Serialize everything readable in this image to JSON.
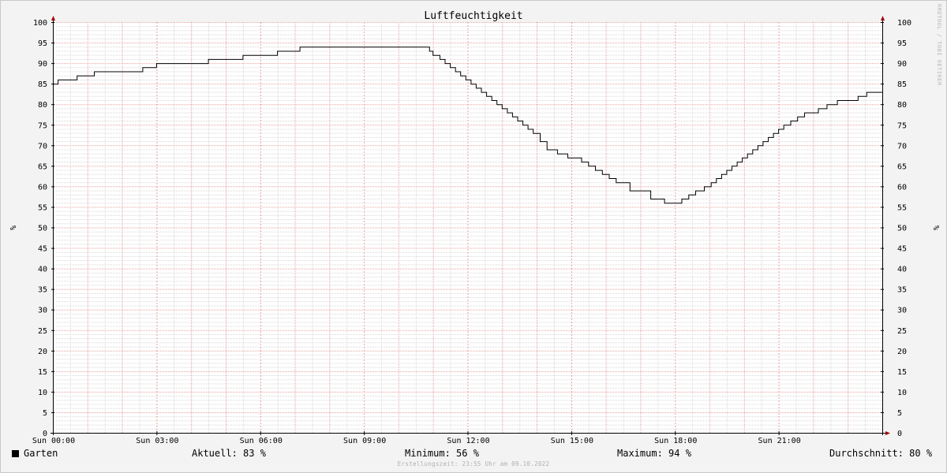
{
  "chart_data": {
    "type": "line",
    "title": "Luftfeuchtigkeit",
    "ylabel": "%",
    "ylim": [
      0,
      100
    ],
    "y_ticks": [
      0,
      5,
      10,
      15,
      20,
      25,
      30,
      35,
      40,
      45,
      50,
      55,
      60,
      65,
      70,
      75,
      80,
      85,
      90,
      95,
      100
    ],
    "x_unit": "hours",
    "xlim": [
      0,
      24
    ],
    "x_tick_values": [
      0,
      3,
      6,
      9,
      12,
      15,
      18,
      21
    ],
    "x_tick_labels": [
      "Sun 00:00",
      "Sun 03:00",
      "Sun 06:00",
      "Sun 09:00",
      "Sun 12:00",
      "Sun 15:00",
      "Sun 18:00",
      "Sun 21:00"
    ],
    "grid": true,
    "step": true,
    "series": [
      {
        "name": "Garten",
        "color": "#000000",
        "x": [
          0,
          0.15,
          0.7,
          1.2,
          1.9,
          2.6,
          2.8,
          3.0,
          3.5,
          4.0,
          4.5,
          5.0,
          5.5,
          5.7,
          6.0,
          6.5,
          7.0,
          7.15,
          7.5,
          8.0,
          8.5,
          9.0,
          9.5,
          10.0,
          10.5,
          10.9,
          11.0,
          11.2,
          11.35,
          11.5,
          11.65,
          11.8,
          11.95,
          12.1,
          12.25,
          12.4,
          12.55,
          12.7,
          12.85,
          13.0,
          13.15,
          13.3,
          13.45,
          13.6,
          13.75,
          13.9,
          14.1,
          14.3,
          14.6,
          14.9,
          15.1,
          15.3,
          15.5,
          15.7,
          15.9,
          16.1,
          16.3,
          16.7,
          16.95,
          17.3,
          17.7,
          18.05,
          18.2,
          18.4,
          18.6,
          18.85,
          19.05,
          19.2,
          19.35,
          19.5,
          19.65,
          19.8,
          19.95,
          20.1,
          20.25,
          20.4,
          20.55,
          20.7,
          20.85,
          21.0,
          21.15,
          21.35,
          21.55,
          21.75,
          21.95,
          22.15,
          22.4,
          22.7,
          23.0,
          23.3,
          23.55,
          23.75,
          24.0
        ],
        "y": [
          85,
          86,
          87,
          88,
          88,
          89,
          89,
          90,
          90,
          90,
          91,
          91,
          92,
          92,
          92,
          93,
          93,
          94,
          94,
          94,
          94,
          94,
          94,
          94,
          94,
          93,
          92,
          91,
          90,
          89,
          88,
          87,
          86,
          85,
          84,
          83,
          82,
          81,
          80,
          79,
          78,
          77,
          76,
          75,
          74,
          73,
          71,
          69,
          68,
          67,
          67,
          66,
          65,
          64,
          63,
          62,
          61,
          59,
          59,
          57,
          56,
          56,
          57,
          58,
          59,
          60,
          61,
          62,
          63,
          64,
          65,
          66,
          67,
          68,
          69,
          70,
          71,
          72,
          73,
          74,
          75,
          76,
          77,
          78,
          78,
          79,
          80,
          81,
          81,
          82,
          83,
          83,
          83
        ]
      }
    ]
  },
  "watermark": "RRDTOOL / TOBI OETIKER",
  "legend": {
    "series_label": "Garten",
    "current": "Aktuell:  83 %",
    "minimum": "Minimum:  56 %",
    "maximum": "Maximum:  94 %",
    "average": "Durchschnitt:  80 %"
  },
  "footer": "Erstellungszeit: 23:55 Uhr am 09.10.2022",
  "colors": {
    "background": "#f3f3f3",
    "plot_background": "#ffffff",
    "major_grid": "#e8a0a0",
    "minor_grid": "#d8d8d8",
    "axis": "#000000",
    "arrow": "#a00000"
  }
}
